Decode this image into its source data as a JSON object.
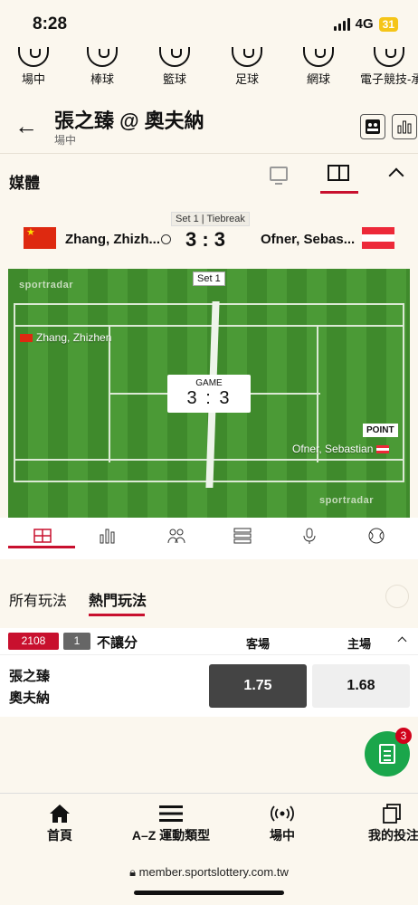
{
  "status": {
    "time": "8:28",
    "network": "4G",
    "battery": "31"
  },
  "sports_nav": [
    {
      "label": "場中",
      "icon": "live-icon"
    },
    {
      "label": "棒球",
      "icon": "baseball-icon"
    },
    {
      "label": "籃球",
      "icon": "basketball-icon"
    },
    {
      "label": "足球",
      "icon": "soccer-icon"
    },
    {
      "label": "網球",
      "icon": "tennis-icon"
    },
    {
      "label": "電子競技-承",
      "icon": "esports-icon"
    }
  ],
  "header": {
    "title": "張之臻 @ 奧夫納",
    "subtitle": "場中"
  },
  "media": {
    "title": "媒體"
  },
  "scoreboard": {
    "set_label": "Set 1 | Tiebreak",
    "player_home": "Zhang, Zhizh...",
    "player_away": "Ofner, Sebas...",
    "score": "3 : 3"
  },
  "court": {
    "brand_top": "sportradar",
    "brand_bottom": "sportradar",
    "set_badge": "Set 1",
    "player_1": "Zhang, Zhizhen",
    "player_2": "Ofner, Sebastian",
    "game_label": "GAME",
    "game_score": "3 : 3",
    "point_label": "POINT"
  },
  "market_tabs": [
    {
      "label": "所有玩法",
      "active": false
    },
    {
      "label": "熱門玩法",
      "active": true
    }
  ],
  "market": {
    "id": "2108",
    "count": "1",
    "name": "不讓分",
    "col_away": "客場",
    "col_home": "主場",
    "team_1": "張之臻",
    "team_2": "奧夫納",
    "odds_away": "1.75",
    "odds_home": "1.68"
  },
  "fab": {
    "badge": "3"
  },
  "bottom_nav": [
    {
      "label": "首頁",
      "icon": "home-icon"
    },
    {
      "label": "A–Z 運動類型",
      "icon": "menu-icon"
    },
    {
      "label": "場中",
      "icon": "live-icon"
    },
    {
      "label": "我的投注",
      "icon": "bets-icon"
    }
  ],
  "browser": {
    "url": "member.sportslottery.com.tw"
  },
  "colors": {
    "accent": "#c8102e",
    "green": "#1aa64b",
    "selected_odd": "#444444"
  }
}
